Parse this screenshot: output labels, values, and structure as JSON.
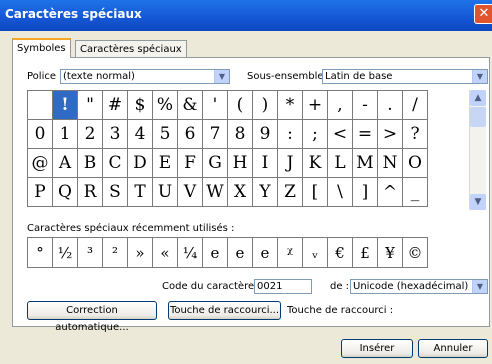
{
  "window": {
    "title": "Caractères spéciaux",
    "close_glyph": "✕"
  },
  "tabs": [
    {
      "label": "Symboles",
      "active": true
    },
    {
      "label": "Caractères spéciaux",
      "active": false
    }
  ],
  "font": {
    "label": "Police :",
    "value": "(texte normal)"
  },
  "subset": {
    "label": "Sous-ensemble :",
    "value": "Latin de base"
  },
  "symbol_rows": [
    [
      "",
      "!",
      "\"",
      "#",
      "$",
      "%",
      "&",
      "'",
      "(",
      ")",
      "*",
      "+",
      ",",
      "-",
      ".",
      "/"
    ],
    [
      "0",
      "1",
      "2",
      "3",
      "4",
      "5",
      "6",
      "7",
      "8",
      "9",
      ":",
      ";",
      "<",
      "=",
      ">",
      "?"
    ],
    [
      "@",
      "A",
      "B",
      "C",
      "D",
      "E",
      "F",
      "G",
      "H",
      "I",
      "J",
      "K",
      "L",
      "M",
      "N",
      "O"
    ],
    [
      "P",
      "Q",
      "R",
      "S",
      "T",
      "U",
      "V",
      "W",
      "X",
      "Y",
      "Z",
      "[",
      "\\",
      "]",
      "^",
      "_"
    ]
  ],
  "selected_symbol": "!",
  "recent": {
    "label": "Caractères spéciaux récemment utilisés :",
    "symbols": [
      "°",
      "½",
      "³",
      "²",
      "»",
      "«",
      "¼",
      "e",
      "e",
      "e",
      "ᵡ",
      "ᵥ",
      "€",
      "£",
      "¥",
      "©"
    ]
  },
  "char_code": {
    "label": "Code du caractère :",
    "value": "0021"
  },
  "from": {
    "label": "de :",
    "value": "Unicode (hexadécimal)"
  },
  "buttons": {
    "autocorrect": "Correction automatique...",
    "shortcut_key": "Touche de raccourci...",
    "insert": "Insérer",
    "cancel": "Annuler"
  },
  "shortcut_label": "Touche de raccourci :",
  "icons": {
    "dropdown": "chevron-down-icon",
    "scroll_up": "arrow-up-icon",
    "scroll_down": "arrow-down-icon",
    "close": "close-icon"
  }
}
